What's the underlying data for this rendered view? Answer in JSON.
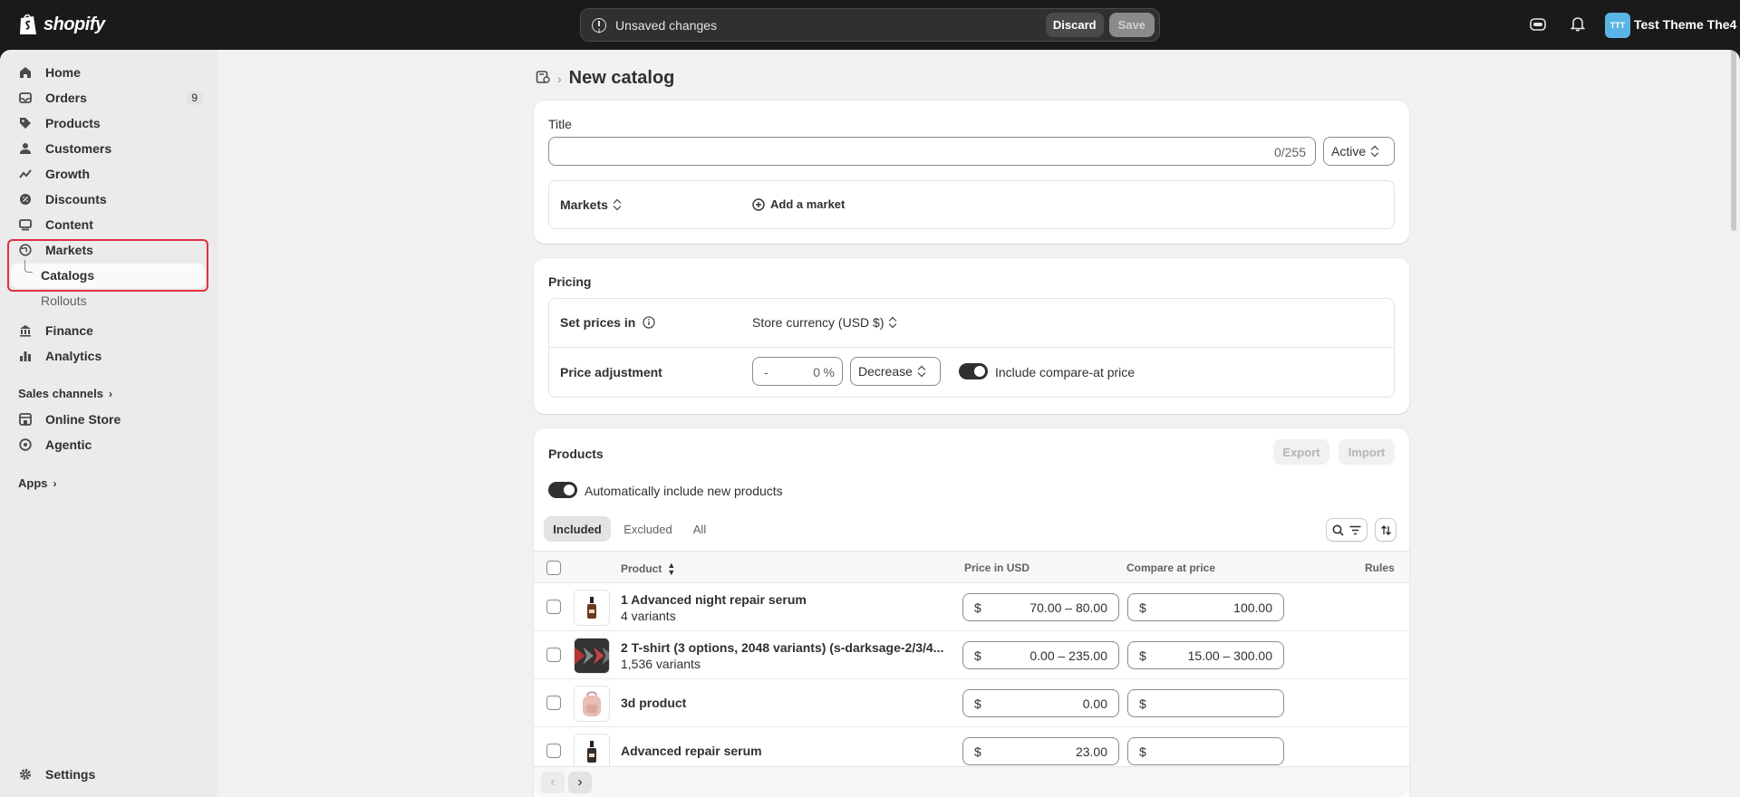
{
  "topbar": {
    "logo_text": "shopify",
    "unsaved_text": "Unsaved changes",
    "discard_label": "Discard",
    "save_label": "Save",
    "avatar_initials": "TTT",
    "store_name": "Test Theme The4"
  },
  "sidebar": {
    "items": [
      {
        "label": "Home",
        "icon": "home-icon"
      },
      {
        "label": "Orders",
        "icon": "orders-icon",
        "badge": "9"
      },
      {
        "label": "Products",
        "icon": "tag-icon"
      },
      {
        "label": "Customers",
        "icon": "person-icon"
      },
      {
        "label": "Growth",
        "icon": "growth-icon"
      },
      {
        "label": "Discounts",
        "icon": "discount-icon"
      },
      {
        "label": "Content",
        "icon": "content-icon"
      },
      {
        "label": "Markets",
        "icon": "globe-icon"
      },
      {
        "label": "Catalogs"
      },
      {
        "label": "Rollouts"
      },
      {
        "label": "Finance",
        "icon": "bank-icon"
      },
      {
        "label": "Analytics",
        "icon": "chart-icon"
      }
    ],
    "sales_channels_label": "Sales channels",
    "channels": [
      {
        "label": "Online Store",
        "icon": "store-icon"
      },
      {
        "label": "Agentic",
        "icon": "agentic-icon"
      }
    ],
    "apps_label": "Apps",
    "settings_label": "Settings"
  },
  "page": {
    "title": "New catalog"
  },
  "title_card": {
    "title_label": "Title",
    "title_value": "",
    "char_count": "0/255",
    "status_value": "Active",
    "markets_label": "Markets",
    "add_market_label": "Add a market"
  },
  "pricing_card": {
    "heading": "Pricing",
    "set_prices_label": "Set prices in",
    "currency_value": "Store currency (USD $)",
    "adjustment_label": "Price adjustment",
    "adjustment_sign": "-",
    "adjustment_value": "0",
    "adjustment_unit": "%",
    "direction_value": "Decrease",
    "compare_at_toggle_label": "Include compare-at price",
    "compare_at_toggle_on": true
  },
  "products_card": {
    "heading": "Products",
    "export_label": "Export",
    "import_label": "Import",
    "auto_include_label": "Automatically include new products",
    "auto_include_on": true,
    "tabs": [
      {
        "label": "Included",
        "active": true
      },
      {
        "label": "Excluded",
        "active": false
      },
      {
        "label": "All",
        "active": false
      }
    ],
    "columns": {
      "product": "Product",
      "price": "Price in USD",
      "compare": "Compare at price",
      "rules": "Rules"
    },
    "currency_symbol": "$",
    "rows": [
      {
        "name": "1 Advanced night repair serum",
        "variants": "4 variants",
        "price": "70.00 – 80.00",
        "compare": "100.00",
        "thumb": "serum-bottle"
      },
      {
        "name": "2 T-shirt (3 options, 2048 variants) (s-darksage-2/3/4...",
        "variants": "1,536 variants",
        "price": "0.00 – 235.00",
        "compare": "15.00 – 300.00",
        "thumb": "tshirt-pattern"
      },
      {
        "name": "3d product",
        "variants": "",
        "price": "0.00",
        "compare": "",
        "thumb": "backpack"
      },
      {
        "name": "Advanced repair serum",
        "variants": "",
        "price": "23.00",
        "compare": "",
        "thumb": "serum-bottle"
      }
    ]
  },
  "colors": {
    "topbar_bg": "#1a1a1a",
    "frame_bg": "#f1f1f1",
    "sidebar_bg": "#ebebeb",
    "highlight_border": "#e0313e",
    "avatar_bg": "#5ab4e6"
  }
}
